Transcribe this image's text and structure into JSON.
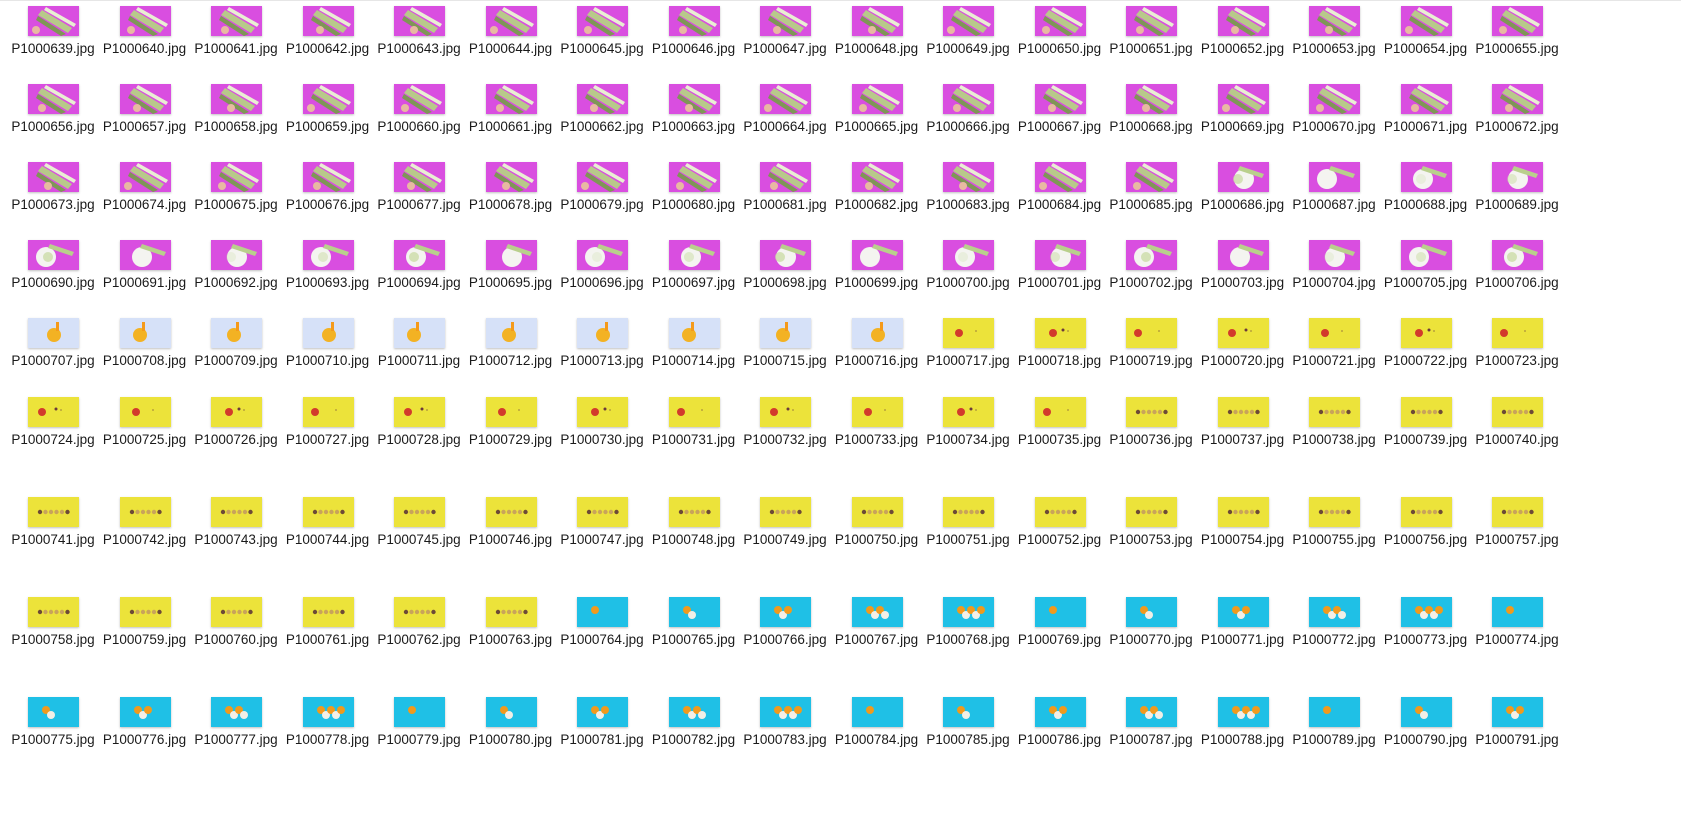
{
  "window": {
    "view": "Explorer large icons view"
  },
  "themes": {
    "magenta_zucchini": {
      "bg": "#d94ee0"
    },
    "magenta_bowl": {
      "bg": "#d94ee0"
    },
    "lavender_drink": {
      "bg": "#c9d9f3"
    },
    "yellow_fruit": {
      "bg": "#ece33a"
    },
    "yellow_row": {
      "bg": "#ece33a"
    },
    "cyan_orange": {
      "bg": "#1fc0e6"
    }
  },
  "files": [
    {
      "name": "P1000639.jpg",
      "theme": "magenta_zucchini"
    },
    {
      "name": "P1000640.jpg",
      "theme": "magenta_zucchini"
    },
    {
      "name": "P1000641.jpg",
      "theme": "magenta_zucchini"
    },
    {
      "name": "P1000642.jpg",
      "theme": "magenta_zucchini"
    },
    {
      "name": "P1000643.jpg",
      "theme": "magenta_zucchini"
    },
    {
      "name": "P1000644.jpg",
      "theme": "magenta_zucchini"
    },
    {
      "name": "P1000645.jpg",
      "theme": "magenta_zucchini"
    },
    {
      "name": "P1000646.jpg",
      "theme": "magenta_zucchini"
    },
    {
      "name": "P1000647.jpg",
      "theme": "magenta_zucchini"
    },
    {
      "name": "P1000648.jpg",
      "theme": "magenta_zucchini"
    },
    {
      "name": "P1000649.jpg",
      "theme": "magenta_zucchini"
    },
    {
      "name": "P1000650.jpg",
      "theme": "magenta_zucchini"
    },
    {
      "name": "P1000651.jpg",
      "theme": "magenta_zucchini"
    },
    {
      "name": "P1000652.jpg",
      "theme": "magenta_zucchini"
    },
    {
      "name": "P1000653.jpg",
      "theme": "magenta_zucchini"
    },
    {
      "name": "P1000654.jpg",
      "theme": "magenta_zucchini"
    },
    {
      "name": "P1000655.jpg",
      "theme": "magenta_zucchini"
    },
    {
      "name": "P1000656.jpg",
      "theme": "magenta_zucchini"
    },
    {
      "name": "P1000657.jpg",
      "theme": "magenta_zucchini"
    },
    {
      "name": "P1000658.jpg",
      "theme": "magenta_zucchini"
    },
    {
      "name": "P1000659.jpg",
      "theme": "magenta_zucchini"
    },
    {
      "name": "P1000660.jpg",
      "theme": "magenta_zucchini"
    },
    {
      "name": "P1000661.jpg",
      "theme": "magenta_zucchini"
    },
    {
      "name": "P1000662.jpg",
      "theme": "magenta_zucchini"
    },
    {
      "name": "P1000663.jpg",
      "theme": "magenta_zucchini"
    },
    {
      "name": "P1000664.jpg",
      "theme": "magenta_zucchini"
    },
    {
      "name": "P1000665.jpg",
      "theme": "magenta_zucchini"
    },
    {
      "name": "P1000666.jpg",
      "theme": "magenta_zucchini"
    },
    {
      "name": "P1000667.jpg",
      "theme": "magenta_zucchini"
    },
    {
      "name": "P1000668.jpg",
      "theme": "magenta_zucchini"
    },
    {
      "name": "P1000669.jpg",
      "theme": "magenta_zucchini"
    },
    {
      "name": "P1000670.jpg",
      "theme": "magenta_zucchini"
    },
    {
      "name": "P1000671.jpg",
      "theme": "magenta_zucchini"
    },
    {
      "name": "P1000672.jpg",
      "theme": "magenta_zucchini"
    },
    {
      "name": "P1000673.jpg",
      "theme": "magenta_zucchini"
    },
    {
      "name": "P1000674.jpg",
      "theme": "magenta_zucchini"
    },
    {
      "name": "P1000675.jpg",
      "theme": "magenta_zucchini"
    },
    {
      "name": "P1000676.jpg",
      "theme": "magenta_zucchini"
    },
    {
      "name": "P1000677.jpg",
      "theme": "magenta_zucchini"
    },
    {
      "name": "P1000678.jpg",
      "theme": "magenta_zucchini"
    },
    {
      "name": "P1000679.jpg",
      "theme": "magenta_zucchini"
    },
    {
      "name": "P1000680.jpg",
      "theme": "magenta_zucchini"
    },
    {
      "name": "P1000681.jpg",
      "theme": "magenta_zucchini"
    },
    {
      "name": "P1000682.jpg",
      "theme": "magenta_zucchini"
    },
    {
      "name": "P1000683.jpg",
      "theme": "magenta_zucchini"
    },
    {
      "name": "P1000684.jpg",
      "theme": "magenta_zucchini"
    },
    {
      "name": "P1000685.jpg",
      "theme": "magenta_zucchini"
    },
    {
      "name": "P1000686.jpg",
      "theme": "magenta_bowl"
    },
    {
      "name": "P1000687.jpg",
      "theme": "magenta_bowl"
    },
    {
      "name": "P1000688.jpg",
      "theme": "magenta_bowl"
    },
    {
      "name": "P1000689.jpg",
      "theme": "magenta_bowl"
    },
    {
      "name": "P1000690.jpg",
      "theme": "magenta_bowl"
    },
    {
      "name": "P1000691.jpg",
      "theme": "magenta_bowl"
    },
    {
      "name": "P1000692.jpg",
      "theme": "magenta_bowl"
    },
    {
      "name": "P1000693.jpg",
      "theme": "magenta_bowl"
    },
    {
      "name": "P1000694.jpg",
      "theme": "magenta_bowl"
    },
    {
      "name": "P1000695.jpg",
      "theme": "magenta_bowl"
    },
    {
      "name": "P1000696.jpg",
      "theme": "magenta_bowl"
    },
    {
      "name": "P1000697.jpg",
      "theme": "magenta_bowl"
    },
    {
      "name": "P1000698.jpg",
      "theme": "magenta_bowl"
    },
    {
      "name": "P1000699.jpg",
      "theme": "magenta_bowl"
    },
    {
      "name": "P1000700.jpg",
      "theme": "magenta_bowl"
    },
    {
      "name": "P1000701.jpg",
      "theme": "magenta_bowl"
    },
    {
      "name": "P1000702.jpg",
      "theme": "magenta_bowl"
    },
    {
      "name": "P1000703.jpg",
      "theme": "magenta_bowl"
    },
    {
      "name": "P1000704.jpg",
      "theme": "magenta_bowl"
    },
    {
      "name": "P1000705.jpg",
      "theme": "magenta_bowl"
    },
    {
      "name": "P1000706.jpg",
      "theme": "magenta_bowl"
    },
    {
      "name": "P1000707.jpg",
      "theme": "lavender_drink"
    },
    {
      "name": "P1000708.jpg",
      "theme": "lavender_drink"
    },
    {
      "name": "P1000709.jpg",
      "theme": "lavender_drink"
    },
    {
      "name": "P1000710.jpg",
      "theme": "lavender_drink"
    },
    {
      "name": "P1000711.jpg",
      "theme": "lavender_drink"
    },
    {
      "name": "P1000712.jpg",
      "theme": "lavender_drink"
    },
    {
      "name": "P1000713.jpg",
      "theme": "lavender_drink"
    },
    {
      "name": "P1000714.jpg",
      "theme": "lavender_drink"
    },
    {
      "name": "P1000715.jpg",
      "theme": "lavender_drink"
    },
    {
      "name": "P1000716.jpg",
      "theme": "lavender_drink"
    },
    {
      "name": "P1000717.jpg",
      "theme": "yellow_fruit"
    },
    {
      "name": "P1000718.jpg",
      "theme": "yellow_fruit"
    },
    {
      "name": "P1000719.jpg",
      "theme": "yellow_fruit"
    },
    {
      "name": "P1000720.jpg",
      "theme": "yellow_fruit"
    },
    {
      "name": "P1000721.jpg",
      "theme": "yellow_fruit"
    },
    {
      "name": "P1000722.jpg",
      "theme": "yellow_fruit"
    },
    {
      "name": "P1000723.jpg",
      "theme": "yellow_fruit"
    },
    {
      "name": "P1000724.jpg",
      "theme": "yellow_fruit"
    },
    {
      "name": "P1000725.jpg",
      "theme": "yellow_fruit"
    },
    {
      "name": "P1000726.jpg",
      "theme": "yellow_fruit"
    },
    {
      "name": "P1000727.jpg",
      "theme": "yellow_fruit"
    },
    {
      "name": "P1000728.jpg",
      "theme": "yellow_fruit"
    },
    {
      "name": "P1000729.jpg",
      "theme": "yellow_fruit"
    },
    {
      "name": "P1000730.jpg",
      "theme": "yellow_fruit"
    },
    {
      "name": "P1000731.jpg",
      "theme": "yellow_fruit"
    },
    {
      "name": "P1000732.jpg",
      "theme": "yellow_fruit"
    },
    {
      "name": "P1000733.jpg",
      "theme": "yellow_fruit"
    },
    {
      "name": "P1000734.jpg",
      "theme": "yellow_fruit"
    },
    {
      "name": "P1000735.jpg",
      "theme": "yellow_fruit"
    },
    {
      "name": "P1000736.jpg",
      "theme": "yellow_row"
    },
    {
      "name": "P1000737.jpg",
      "theme": "yellow_row"
    },
    {
      "name": "P1000738.jpg",
      "theme": "yellow_row"
    },
    {
      "name": "P1000739.jpg",
      "theme": "yellow_row"
    },
    {
      "name": "P1000740.jpg",
      "theme": "yellow_row"
    },
    {
      "name": "P1000741.jpg",
      "theme": "yellow_row"
    },
    {
      "name": "P1000742.jpg",
      "theme": "yellow_row"
    },
    {
      "name": "P1000743.jpg",
      "theme": "yellow_row"
    },
    {
      "name": "P1000744.jpg",
      "theme": "yellow_row"
    },
    {
      "name": "P1000745.jpg",
      "theme": "yellow_row"
    },
    {
      "name": "P1000746.jpg",
      "theme": "yellow_row"
    },
    {
      "name": "P1000747.jpg",
      "theme": "yellow_row"
    },
    {
      "name": "P1000748.jpg",
      "theme": "yellow_row"
    },
    {
      "name": "P1000749.jpg",
      "theme": "yellow_row"
    },
    {
      "name": "P1000750.jpg",
      "theme": "yellow_row"
    },
    {
      "name": "P1000751.jpg",
      "theme": "yellow_row"
    },
    {
      "name": "P1000752.jpg",
      "theme": "yellow_row"
    },
    {
      "name": "P1000753.jpg",
      "theme": "yellow_row"
    },
    {
      "name": "P1000754.jpg",
      "theme": "yellow_row"
    },
    {
      "name": "P1000755.jpg",
      "theme": "yellow_row"
    },
    {
      "name": "P1000756.jpg",
      "theme": "yellow_row"
    },
    {
      "name": "P1000757.jpg",
      "theme": "yellow_row"
    },
    {
      "name": "P1000758.jpg",
      "theme": "yellow_row"
    },
    {
      "name": "P1000759.jpg",
      "theme": "yellow_row"
    },
    {
      "name": "P1000760.jpg",
      "theme": "yellow_row"
    },
    {
      "name": "P1000761.jpg",
      "theme": "yellow_row"
    },
    {
      "name": "P1000762.jpg",
      "theme": "yellow_row"
    },
    {
      "name": "P1000763.jpg",
      "theme": "yellow_row"
    },
    {
      "name": "P1000764.jpg",
      "theme": "cyan_orange"
    },
    {
      "name": "P1000765.jpg",
      "theme": "cyan_orange"
    },
    {
      "name": "P1000766.jpg",
      "theme": "cyan_orange"
    },
    {
      "name": "P1000767.jpg",
      "theme": "cyan_orange"
    },
    {
      "name": "P1000768.jpg",
      "theme": "cyan_orange"
    },
    {
      "name": "P1000769.jpg",
      "theme": "cyan_orange"
    },
    {
      "name": "P1000770.jpg",
      "theme": "cyan_orange"
    },
    {
      "name": "P1000771.jpg",
      "theme": "cyan_orange"
    },
    {
      "name": "P1000772.jpg",
      "theme": "cyan_orange"
    },
    {
      "name": "P1000773.jpg",
      "theme": "cyan_orange"
    },
    {
      "name": "P1000774.jpg",
      "theme": "cyan_orange"
    },
    {
      "name": "P1000775.jpg",
      "theme": "cyan_orange"
    },
    {
      "name": "P1000776.jpg",
      "theme": "cyan_orange"
    },
    {
      "name": "P1000777.jpg",
      "theme": "cyan_orange"
    },
    {
      "name": "P1000778.jpg",
      "theme": "cyan_orange"
    },
    {
      "name": "P1000779.jpg",
      "theme": "cyan_orange"
    },
    {
      "name": "P1000780.jpg",
      "theme": "cyan_orange"
    },
    {
      "name": "P1000781.jpg",
      "theme": "cyan_orange"
    },
    {
      "name": "P1000782.jpg",
      "theme": "cyan_orange"
    },
    {
      "name": "P1000783.jpg",
      "theme": "cyan_orange"
    },
    {
      "name": "P1000784.jpg",
      "theme": "cyan_orange"
    },
    {
      "name": "P1000785.jpg",
      "theme": "cyan_orange"
    },
    {
      "name": "P1000786.jpg",
      "theme": "cyan_orange"
    },
    {
      "name": "P1000787.jpg",
      "theme": "cyan_orange"
    },
    {
      "name": "P1000788.jpg",
      "theme": "cyan_orange"
    },
    {
      "name": "P1000789.jpg",
      "theme": "cyan_orange"
    },
    {
      "name": "P1000790.jpg",
      "theme": "cyan_orange"
    },
    {
      "name": "P1000791.jpg",
      "theme": "cyan_orange"
    }
  ]
}
